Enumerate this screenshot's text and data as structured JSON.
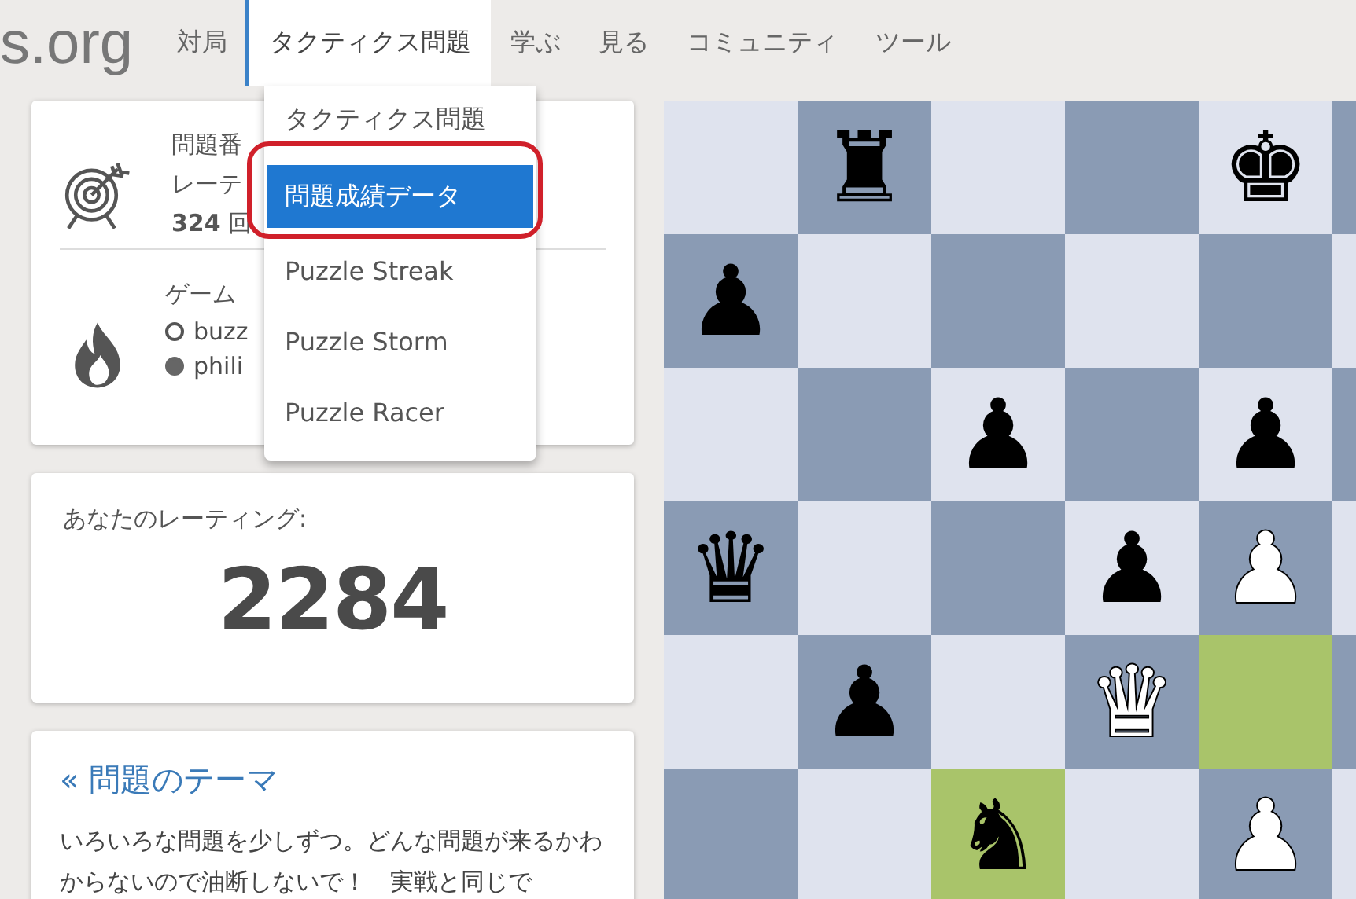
{
  "header": {
    "logo": "s.org",
    "nav": [
      {
        "label": "対局",
        "selected": false
      },
      {
        "label": "タクティクス問題",
        "selected": true
      },
      {
        "label": "学ぶ",
        "selected": false
      },
      {
        "label": "見る",
        "selected": false
      },
      {
        "label": "コミュニティ",
        "selected": false
      },
      {
        "label": "ツール",
        "selected": false
      }
    ]
  },
  "dropdown": {
    "items": [
      {
        "label": "タクティクス問題",
        "selected": false
      },
      {
        "label": "問題成績データ",
        "selected": true
      },
      {
        "label": "Puzzle Streak",
        "selected": false
      },
      {
        "label": "Puzzle Storm",
        "selected": false
      },
      {
        "label": "Puzzle Racer",
        "selected": false
      }
    ]
  },
  "puzzle_card": {
    "lines": [
      "問題番",
      "レーテ"
    ],
    "plays": "**324** 回",
    "game_title": "ゲーム",
    "players": [
      {
        "name": "buzz",
        "filled": false
      },
      {
        "name": "phili",
        "filled": true
      }
    ]
  },
  "rating_card": {
    "label": "あなたのレーティング:",
    "value": "2284"
  },
  "theme_card": {
    "link": "« 問題のテーマ",
    "text": "いろいろな問題を少しずつ。どんな問題が来るかわからないので油断しないで！　実戦と同じで"
  },
  "board": {
    "rows": [
      [
        {
          "highlight": false
        },
        {
          "piece": "♜",
          "white": false,
          "highlight": false
        },
        {
          "highlight": false
        },
        {
          "highlight": false
        },
        {
          "piece": "♚",
          "white": false,
          "highlight": false
        },
        {
          "highlight": false
        }
      ],
      [
        {
          "piece": "♟",
          "white": false,
          "highlight": false
        },
        {
          "highlight": false
        },
        {
          "highlight": false
        },
        {
          "highlight": false
        },
        {
          "highlight": false
        },
        {
          "highlight": false
        }
      ],
      [
        {
          "highlight": false
        },
        {
          "highlight": false
        },
        {
          "piece": "♟",
          "white": false,
          "highlight": false
        },
        {
          "highlight": false
        },
        {
          "piece": "♟",
          "white": false,
          "highlight": false
        },
        {
          "highlight": false
        }
      ],
      [
        {
          "piece": "♛",
          "white": false,
          "highlight": false
        },
        {
          "highlight": false
        },
        {
          "highlight": false
        },
        {
          "piece": "♟",
          "white": false,
          "highlight": false
        },
        {
          "piece": "♟",
          "white": true,
          "highlight": false
        },
        {
          "highlight": false
        }
      ],
      [
        {
          "highlight": false
        },
        {
          "piece": "♟",
          "white": false,
          "highlight": false
        },
        {
          "highlight": false
        },
        {
          "piece": "♛",
          "white": true,
          "highlight": false
        },
        {
          "highlight": true
        },
        {
          "highlight": false
        }
      ],
      [
        {
          "highlight": false
        },
        {
          "highlight": false
        },
        {
          "piece": "♞",
          "white": false,
          "highlight": true
        },
        {
          "highlight": false
        },
        {
          "piece": "♟",
          "white": true,
          "highlight": false
        },
        {
          "highlight": false
        }
      ]
    ]
  }
}
